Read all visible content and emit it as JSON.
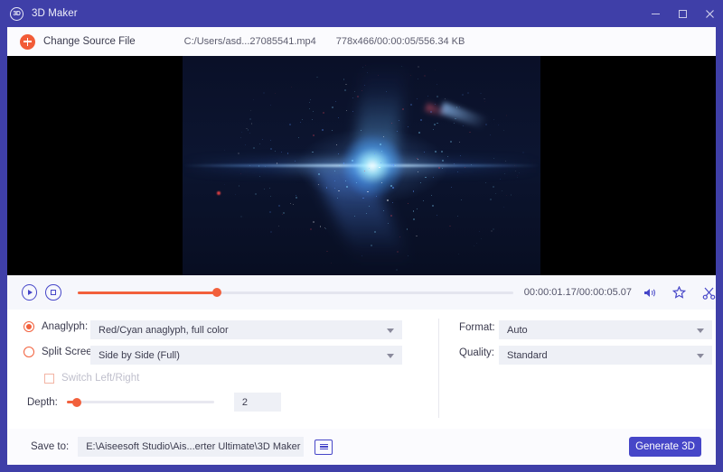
{
  "window": {
    "title": "3D Maker",
    "logo_text": "3D",
    "minimize": "minimize",
    "maximize": "maximize",
    "close": "close"
  },
  "source_bar": {
    "change_button_label": "Change Source File",
    "file_path": "C:/Users/asd...27085541.mp4",
    "file_info": "778x466/00:00:05/556.34 KB"
  },
  "player": {
    "play_label": "Play",
    "stop_label": "Stop",
    "time": "00:00:01.17/00:00:05.07",
    "progress_percent": 32,
    "volume_icon": "volume-icon",
    "snapshot_icon": "snapshot-icon",
    "cut_icon": "scissors-icon"
  },
  "options": {
    "anaglyph": {
      "label": "Anaglyph:",
      "selected": true,
      "value": "Red/Cyan anaglyph, full color"
    },
    "split_screen": {
      "label": "Split Screen:",
      "selected": false,
      "value": "Side by Side (Full)"
    },
    "switch_lr": {
      "label": "Switch Left/Right",
      "checked": false,
      "disabled": true
    },
    "depth": {
      "label": "Depth:",
      "value": "2",
      "percent": 7
    },
    "format": {
      "label": "Format:",
      "value": "Auto"
    },
    "quality": {
      "label": "Quality:",
      "value": "Standard"
    }
  },
  "save_bar": {
    "label": "Save to:",
    "path": "E:\\Aiseesoft Studio\\Ais...erter Ultimate\\3D Maker",
    "browse_icon": "folder-icon",
    "generate_label": "Generate 3D"
  },
  "colors": {
    "title_bar": "#3f3fa8",
    "accent_orange": "#f2603c",
    "accent_purple": "#4646c8"
  }
}
